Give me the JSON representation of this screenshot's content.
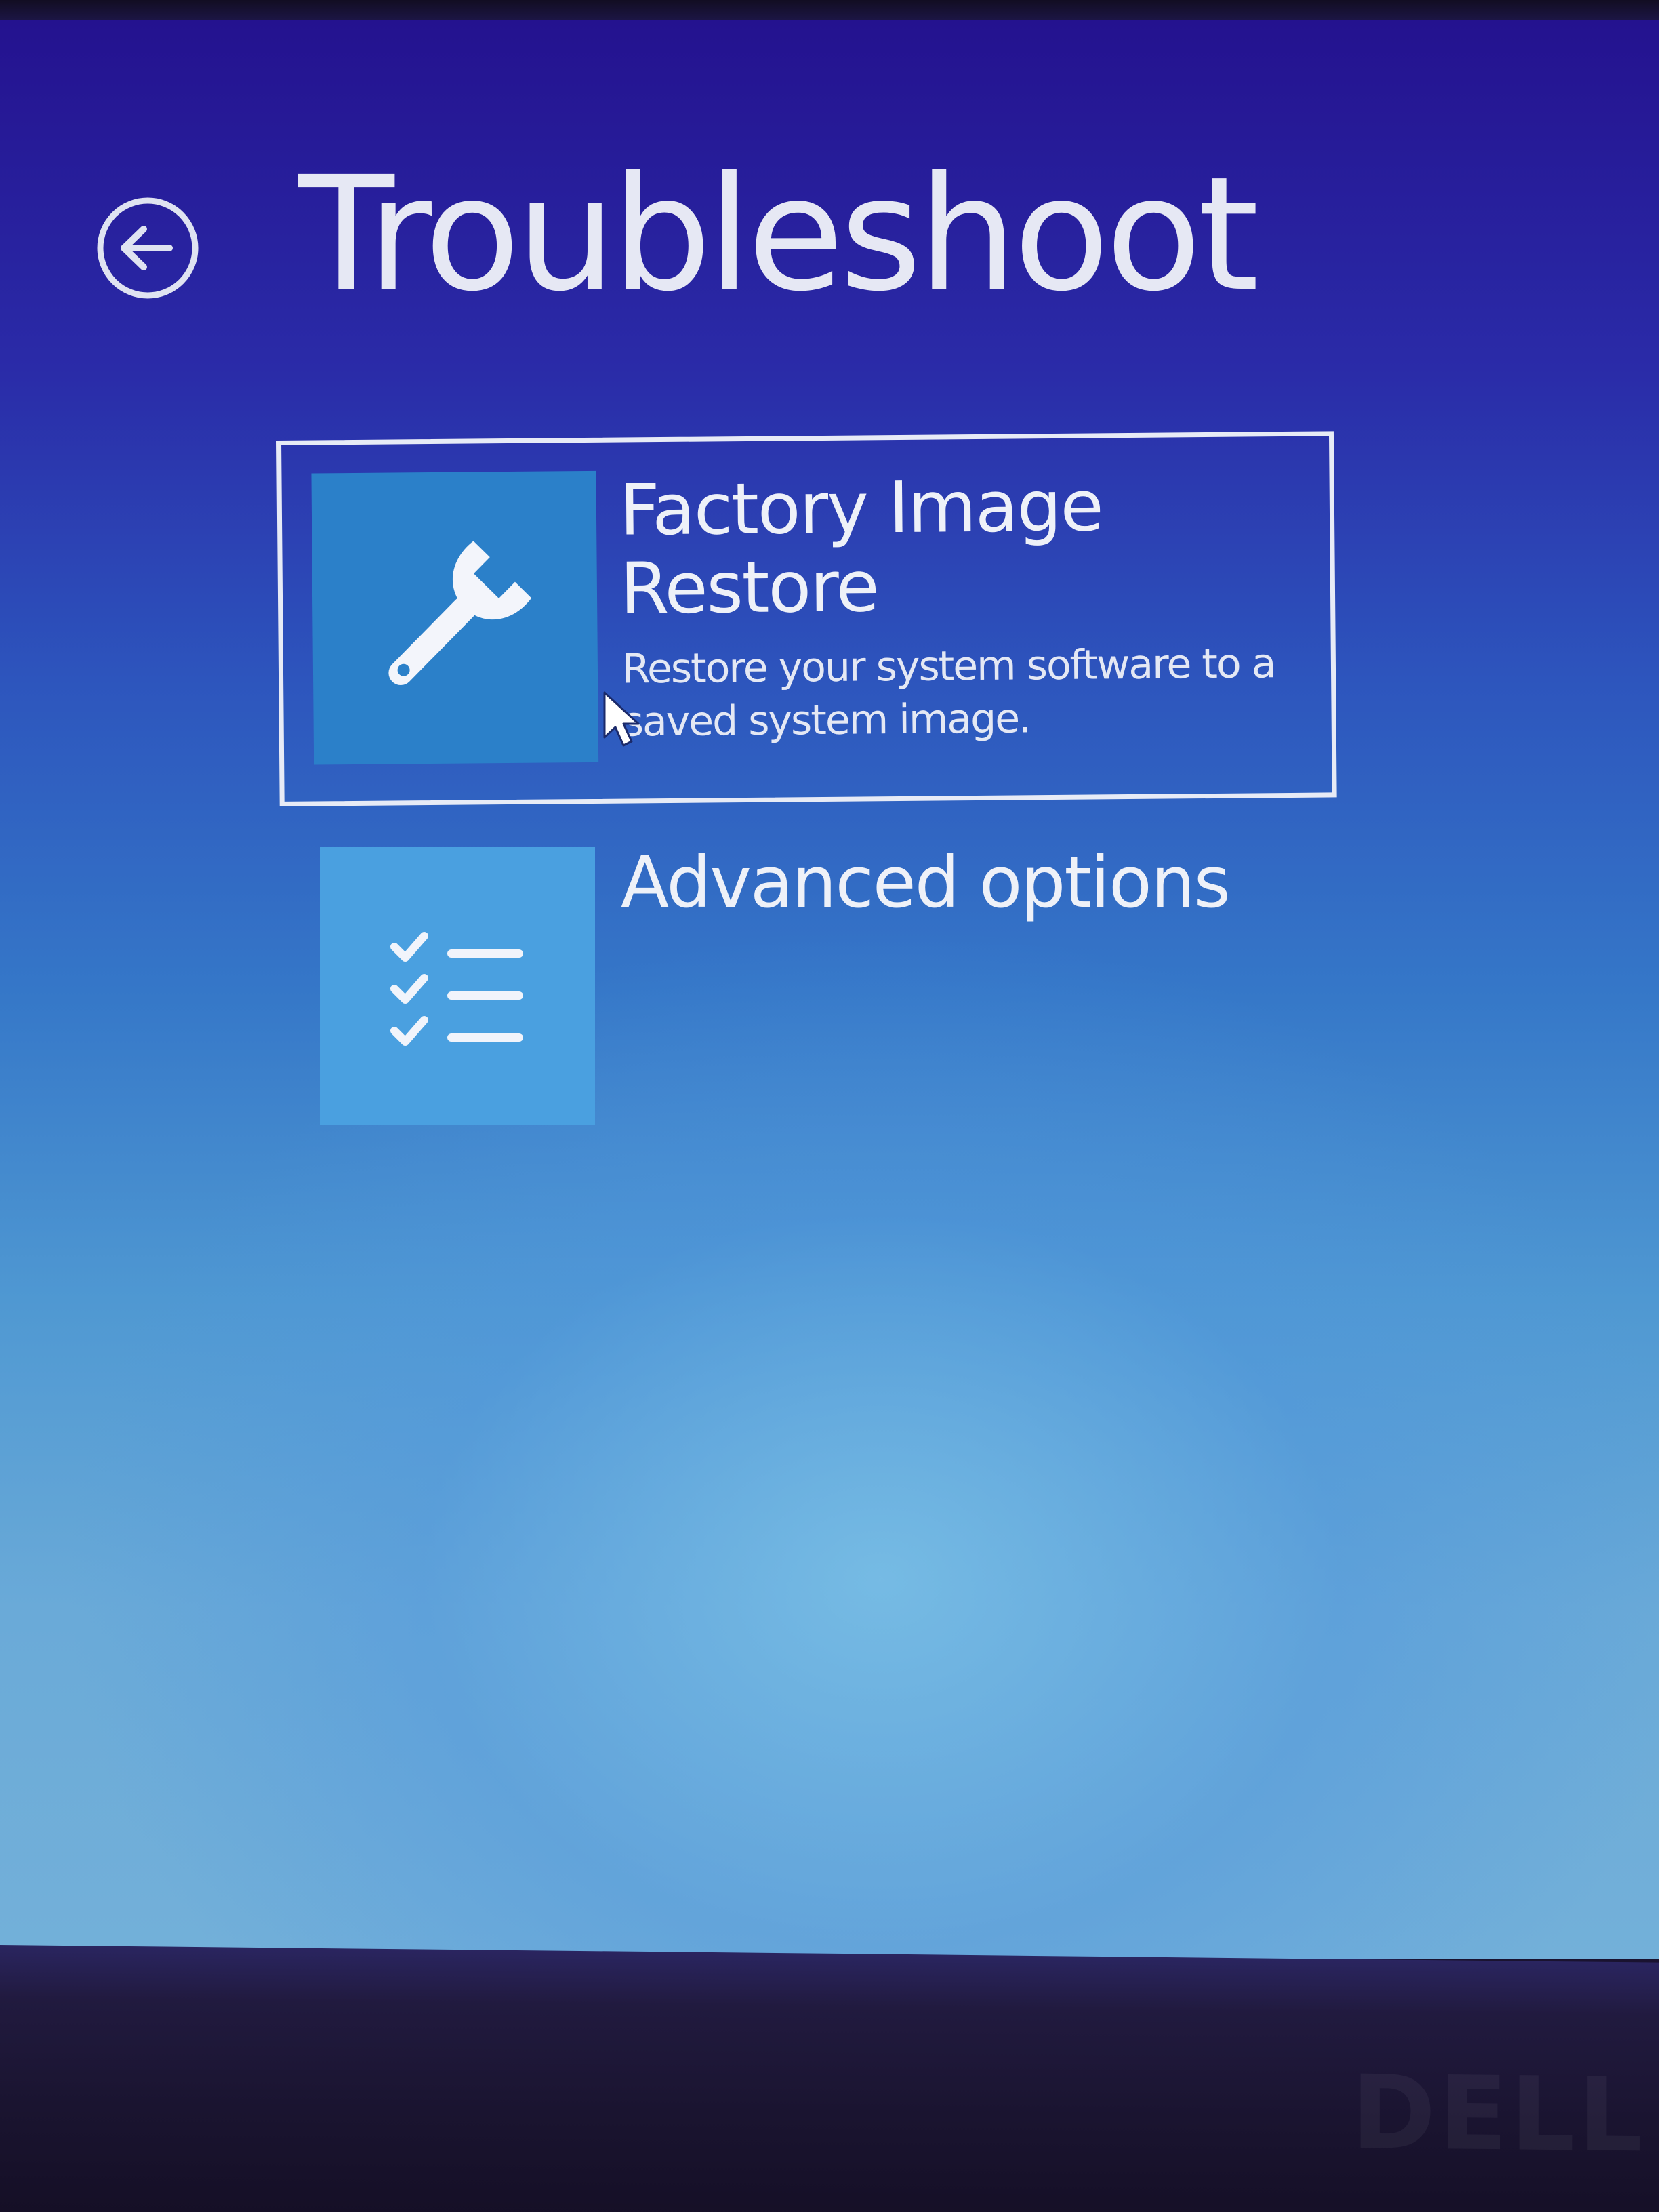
{
  "header": {
    "title": "Troubleshoot",
    "back_icon": "back-arrow-circle-icon"
  },
  "options": [
    {
      "title_line1": "Factory Image",
      "title_line2": "Restore",
      "description_line1": "Restore your system software to a",
      "description_line2": "saved system image.",
      "icon": "wrench-icon",
      "selected": true
    },
    {
      "title_line1": "Advanced options",
      "icon": "checklist-icon",
      "selected": false
    }
  ],
  "colors": {
    "text": "#e6e8f4",
    "selected_tile": "#2b80c9",
    "tile": "#4aa0e0",
    "background_top": "#24128f",
    "background_bottom": "#73b0d9"
  }
}
